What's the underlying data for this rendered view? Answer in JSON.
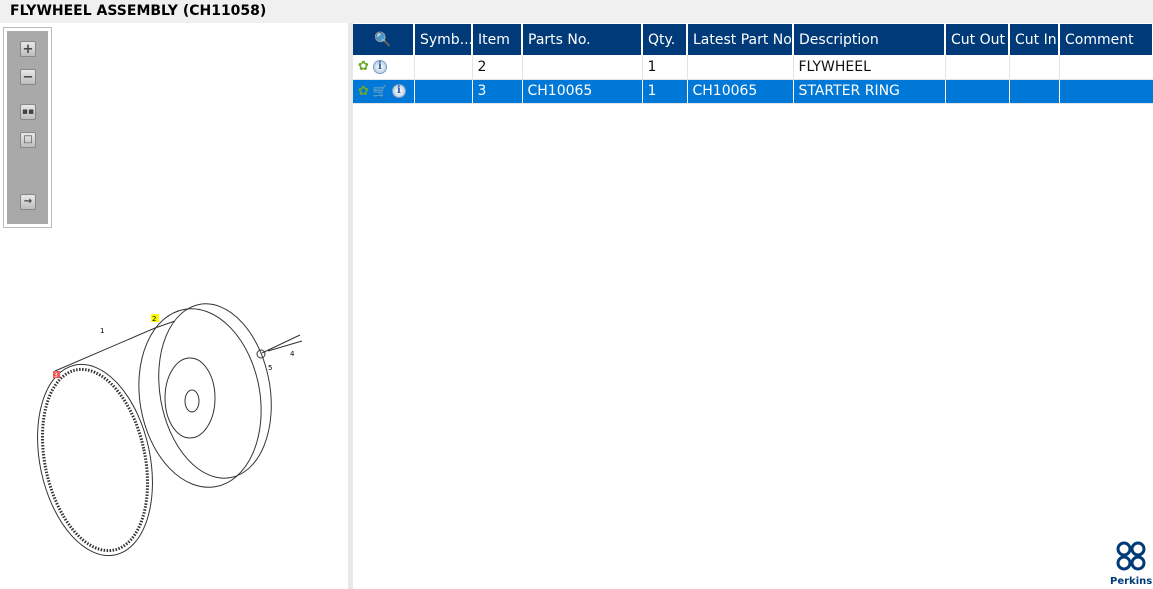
{
  "title": "FLYWHEEL ASSEMBLY (CH11058)",
  "toolbar": {
    "buttons": [
      "zoom-in",
      "zoom-out",
      "fit-all",
      "fit-window",
      "export"
    ]
  },
  "diagram": {
    "callouts": [
      "1",
      "2",
      "3",
      "4",
      "5"
    ]
  },
  "table": {
    "headers": [
      "",
      "Symb...",
      "Item",
      "Parts No.",
      "Qty.",
      "Latest Part No.",
      "Description",
      "Cut Out",
      "Cut In",
      "Comment"
    ],
    "rows": [
      {
        "item": "2",
        "parts_no": "",
        "qty": "1",
        "latest": "",
        "description": "FLYWHEEL",
        "cut_out": "",
        "cut_in": "",
        "comment": "",
        "selected": false
      },
      {
        "item": "3",
        "parts_no": "CH10065",
        "qty": "1",
        "latest": "CH10065",
        "description": "STARTER RING",
        "cut_out": "",
        "cut_in": "",
        "comment": "",
        "selected": true
      }
    ]
  },
  "logo": "Perkins",
  "colors": {
    "header": "#003a78",
    "selected": "#0078d7"
  }
}
